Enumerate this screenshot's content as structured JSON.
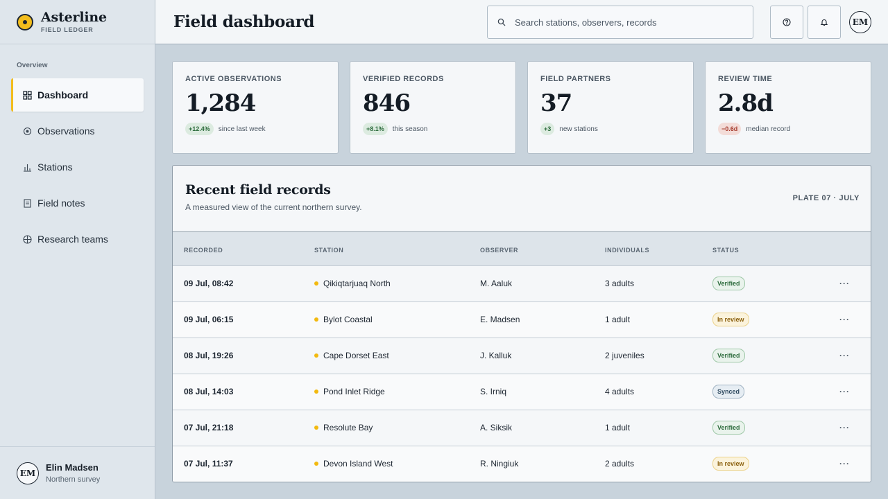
{
  "brand": {
    "name": "Asterline",
    "subtitle": "FIELD LEDGER"
  },
  "sidebar": {
    "section_label": "Overview",
    "items": [
      {
        "label": "Dashboard",
        "icon": "grid-icon",
        "active": true
      },
      {
        "label": "Observations",
        "icon": "target-icon",
        "active": false
      },
      {
        "label": "Stations",
        "icon": "bar-chart-icon",
        "active": false
      },
      {
        "label": "Field notes",
        "icon": "document-icon",
        "active": false
      },
      {
        "label": "Research teams",
        "icon": "globe-icon",
        "active": false
      }
    ],
    "user": {
      "initials": "EM",
      "name": "Elin Madsen",
      "role": "Northern survey"
    }
  },
  "header": {
    "title": "Field dashboard",
    "search_placeholder": "Search stations, observers, records",
    "avatar_initials": "EM"
  },
  "stats": [
    {
      "label": "ACTIVE OBSERVATIONS",
      "value": "1,284",
      "delta": "+12.4%",
      "note": "since last week",
      "trend": "up"
    },
    {
      "label": "VERIFIED RECORDS",
      "value": "846",
      "delta": "+8.1%",
      "note": "this season",
      "trend": "up"
    },
    {
      "label": "FIELD PARTNERS",
      "value": "37",
      "delta": "+3",
      "note": "new stations",
      "trend": "up"
    },
    {
      "label": "REVIEW TIME",
      "value": "2.8d",
      "delta": "−0.6d",
      "note": "median record",
      "trend": "down"
    }
  ],
  "records": {
    "title": "Recent field records",
    "subtitle": "A measured view of the current northern survey.",
    "plate": "PLATE 07 · JULY",
    "columns": [
      "RECORDED",
      "STATION",
      "OBSERVER",
      "INDIVIDUALS",
      "STATUS"
    ],
    "rows": [
      {
        "recorded": "09 Jul, 08:42",
        "station": "Qikiqtarjuaq North",
        "observer": "M. Aaluk",
        "individuals": "3 adults",
        "status": "Verified"
      },
      {
        "recorded": "09 Jul, 06:15",
        "station": "Bylot Coastal",
        "observer": "E. Madsen",
        "individuals": "1 adult",
        "status": "In review"
      },
      {
        "recorded": "08 Jul, 19:26",
        "station": "Cape Dorset East",
        "observer": "J. Kalluk",
        "individuals": "2 juveniles",
        "status": "Verified"
      },
      {
        "recorded": "08 Jul, 14:03",
        "station": "Pond Inlet Ridge",
        "observer": "S. Irniq",
        "individuals": "4 adults",
        "status": "Synced"
      },
      {
        "recorded": "07 Jul, 21:18",
        "station": "Resolute Bay",
        "observer": "A. Siksik",
        "individuals": "1 adult",
        "status": "Verified"
      },
      {
        "recorded": "07 Jul, 11:37",
        "station": "Devon Island West",
        "observer": "R. Ningiuk",
        "individuals": "2 adults",
        "status": "In review"
      }
    ],
    "more_glyph": "···"
  },
  "colors": {
    "accent": "#f2bd1d",
    "background": "#c8d3dc",
    "sidebar": "#dfe6ec",
    "verified": "#2c6b3c",
    "in_review": "#8a5f0c",
    "synced": "#2f4a60",
    "negative": "#a33628"
  }
}
